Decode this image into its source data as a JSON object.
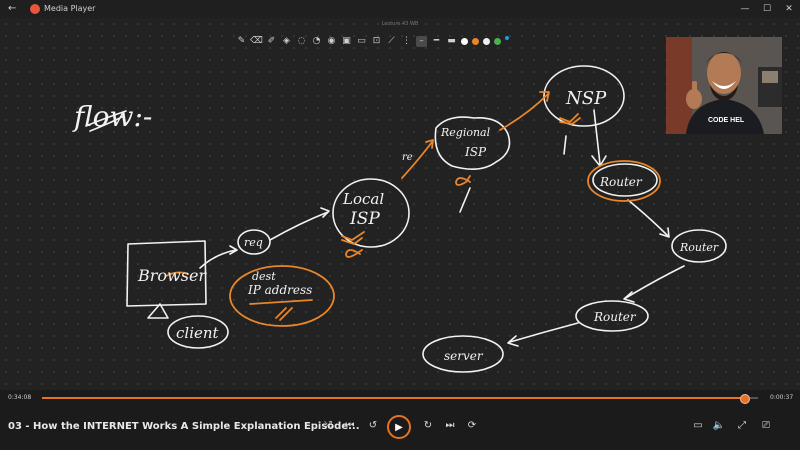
{
  "titlebar": {
    "back_label": "←",
    "app_name": "Media Player",
    "minimize": "—",
    "maximize": "☐",
    "close": "✕"
  },
  "document_title": "Lecture 43 WB",
  "toolbar": {
    "colors": [
      "#ffffff",
      "#e8862a",
      "#ffffff",
      "#4caf50",
      "#2196f3"
    ]
  },
  "whiteboard": {
    "heading": "flow:-",
    "labels": {
      "browser": "Browser",
      "client": "client",
      "req": "req",
      "dest": "dest",
      "ip_address": "IP address",
      "local_isp": [
        "Local",
        "ISP"
      ],
      "regional_isp": [
        "Regional",
        "ISP"
      ],
      "nsp": "NSP",
      "router1": "Router",
      "router2": "Router",
      "router3": "Router",
      "server": "server",
      "re": "re"
    }
  },
  "webcam": {
    "shirt_text": "CODE HEL"
  },
  "player": {
    "elapsed": "0:34:08",
    "remaining": "0:00:37",
    "progress": 0.98,
    "title": "03 - How the INTERNET Works  A Simple Explanation  Episode...",
    "controls": {
      "shuffle": "⤮",
      "prev": "⏮",
      "rewind": "↺",
      "play": "▶",
      "forward": "↻",
      "next": "⏭",
      "repeat": "⟳",
      "miniplayer": "▭",
      "volume": "🔈",
      "fullscreen": "⤢",
      "cast": "⎚"
    }
  }
}
